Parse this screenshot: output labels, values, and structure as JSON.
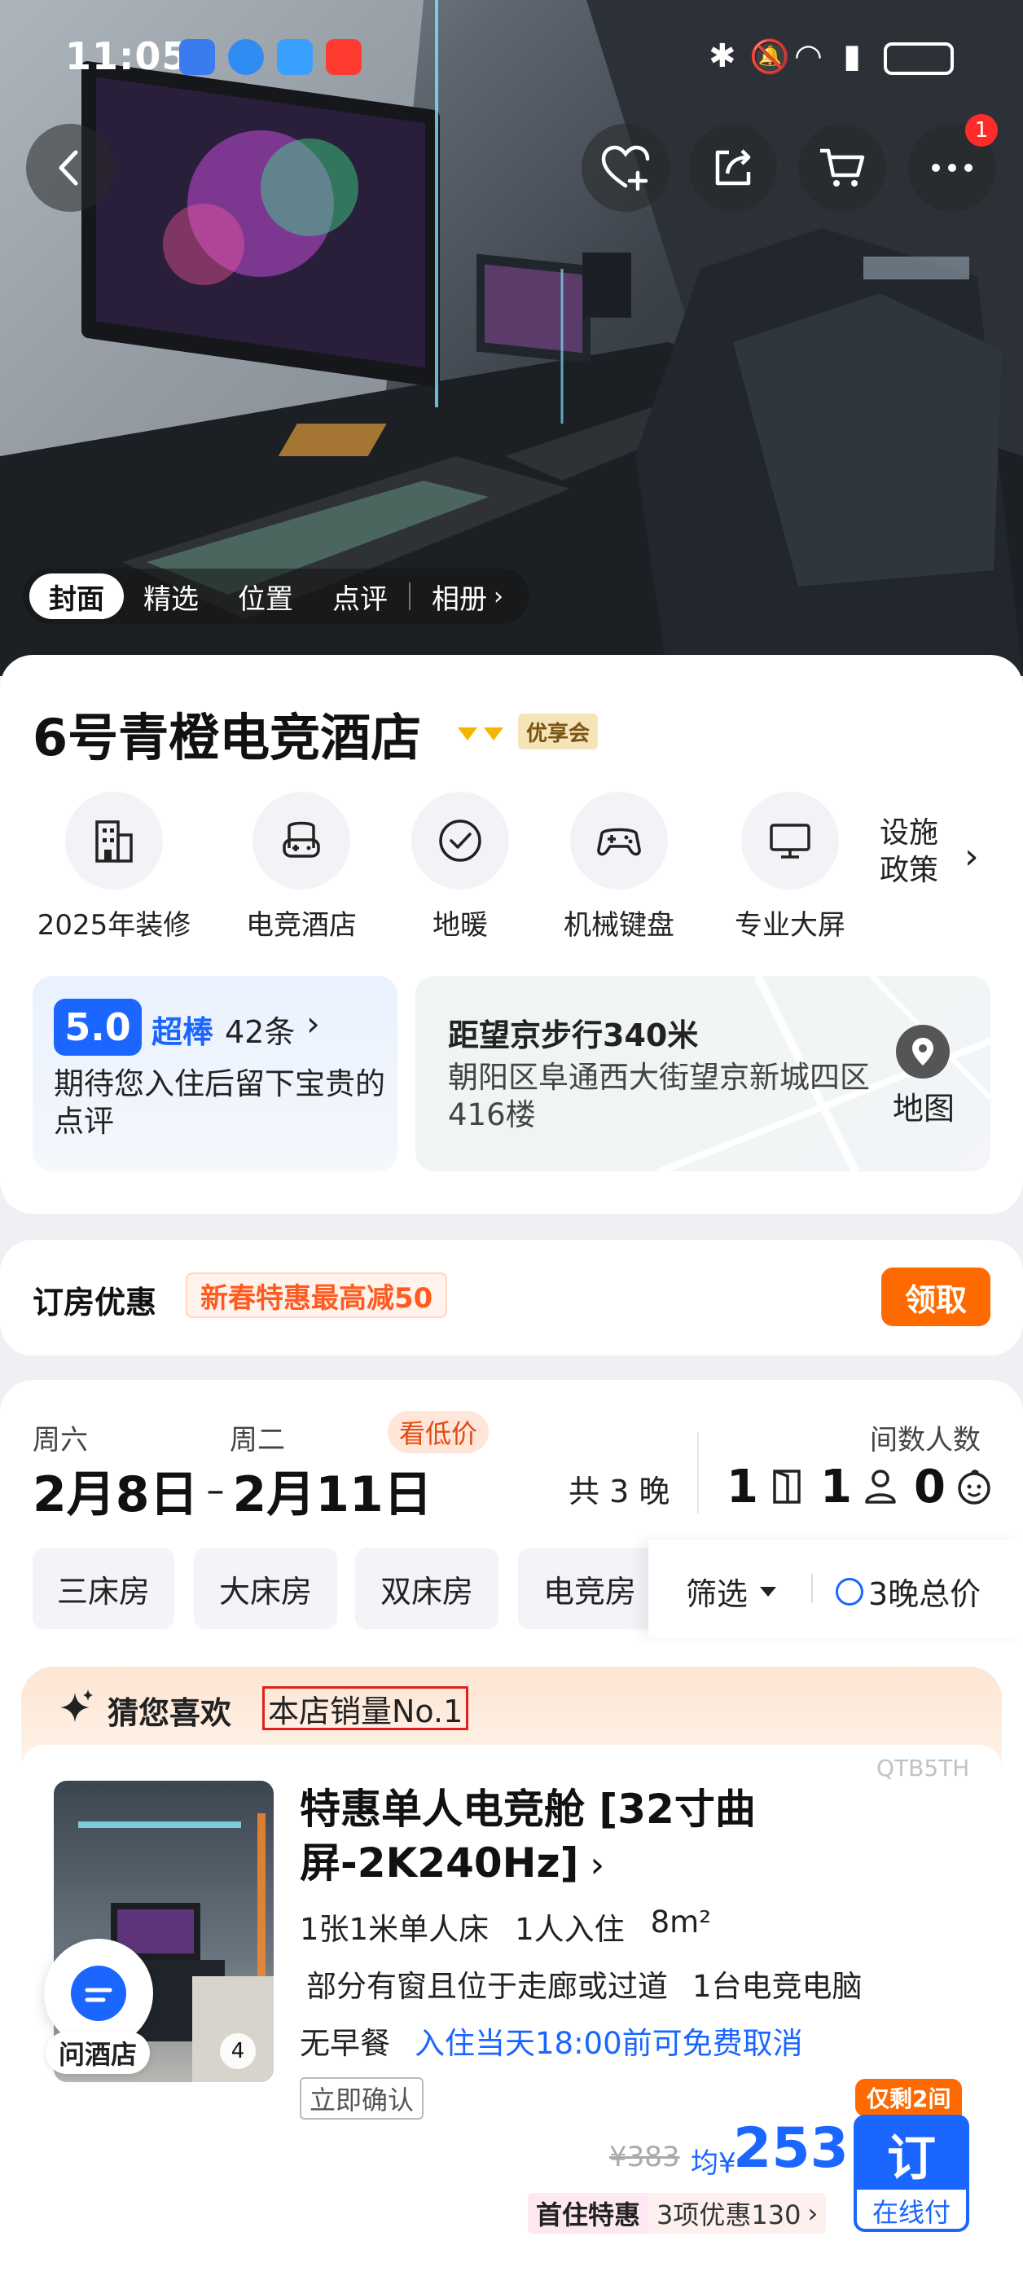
{
  "status_bar": {
    "time": "11:05"
  },
  "hero_tabs": [
    "封面",
    "精选",
    "位置",
    "点评",
    "相册"
  ],
  "cart_badge": "1",
  "hotel": {
    "name": "6号青橙电竞酒店",
    "member_tag": "优享会"
  },
  "features": [
    {
      "label": "2025年装修",
      "icon": "building-icon"
    },
    {
      "label": "电竞酒店",
      "icon": "gamepad-chair-icon"
    },
    {
      "label": "地暖",
      "icon": "check-circle-icon"
    },
    {
      "label": "机械键盘",
      "icon": "gamepad-icon"
    },
    {
      "label": "专业大屏",
      "icon": "monitor-icon"
    }
  ],
  "facility_policy": {
    "line1": "设施",
    "line2": "政策"
  },
  "review": {
    "score": "5.0",
    "level": "超棒",
    "count": "42条",
    "prompt": "期待您入住后留下宝贵的点评"
  },
  "location": {
    "distance": "距望京步行340米",
    "address": "朝阳区阜通西大街望京新城四区416楼",
    "map_label": "地图"
  },
  "promo": {
    "title": "订房优惠",
    "tag": "新春特惠最高减50",
    "button": "领取"
  },
  "dates": {
    "checkin_weekday": "周六",
    "checkout_weekday": "周二",
    "low_price_tag": "看低价",
    "checkin": "2月8日",
    "dash": "–",
    "checkout": "2月11日",
    "nights": "共 3 晚",
    "rooms_label": "间数人数",
    "rooms": "1",
    "adults": "1",
    "children": "0"
  },
  "room_filters": [
    "三床房",
    "大床房",
    "双床房",
    "电竞房"
  ],
  "filter_label": "筛选",
  "total_price_label": "3晚总价",
  "recommend": {
    "title": "猜您喜欢",
    "highlight": "本店销量No.1"
  },
  "room": {
    "code": "QTB5TH",
    "name_line1": "特惠单人电竞舱 [32寸曲",
    "name_line2": "屏-2K240Hz]",
    "bed": "1张1米单人床",
    "occupancy": "1人入住",
    "area": "8m²",
    "window": "部分有窗且位于走廊或过道",
    "pc": "1台电竞电脑",
    "breakfast": "无早餐",
    "cancel": "入住当天18:00前可免费取消",
    "confirm": "立即确认",
    "photo_count": "4",
    "left_tag": "仅剩2间",
    "orig_price": "¥383",
    "avg_label": "均¥",
    "price": "253",
    "book": "订",
    "pay": "在线付",
    "first_stay": "首住特惠",
    "discounts": "3项优惠130"
  },
  "ask_hotel": "问酒店",
  "colors": {
    "accent_blue": "#1a66ff",
    "orange": "#ff6a00",
    "promo_text": "#ff5a1f",
    "highlight_red": "#e0201e"
  }
}
